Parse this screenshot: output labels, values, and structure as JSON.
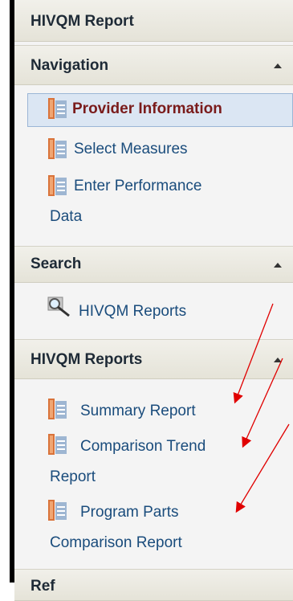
{
  "app_title": "HIVQM Report",
  "sections": {
    "navigation": {
      "title": "Navigation",
      "items": [
        "Provider Information",
        "Select Measures",
        "Enter Performance",
        "Data"
      ]
    },
    "search": {
      "title": "Search",
      "items": [
        "HIVQM Reports"
      ]
    },
    "reports": {
      "title": "HIVQM Reports",
      "items": [
        "Summary Report",
        "Comparison Trend",
        "Report",
        "Program Parts",
        "Comparison Report"
      ]
    },
    "next_header": "Ref"
  },
  "colors": {
    "link": "#1a4c7c",
    "annotation_arrow": "#e00000"
  },
  "icons": {
    "doc_icon": "report-doc-icon",
    "search_icon": "magnifier-icon",
    "collapse_icon": "caret-up-icon"
  }
}
